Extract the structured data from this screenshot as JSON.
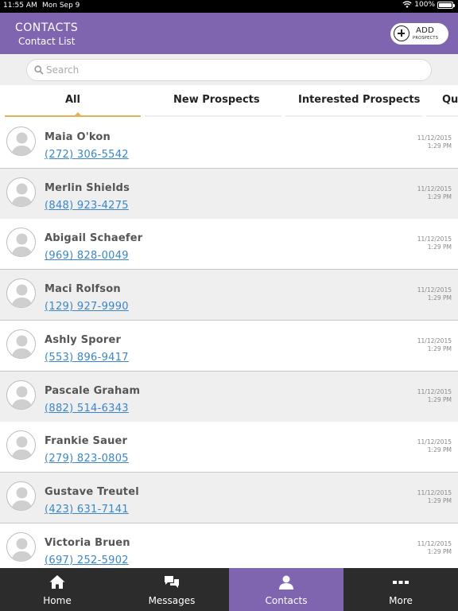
{
  "status_bar": {
    "time": "11:55 AM",
    "date": "Mon Sep 9",
    "battery": "100%"
  },
  "header": {
    "title": "CONTACTS",
    "subtitle": "Contact List",
    "add_button": {
      "label": "ADD",
      "sublabel": "PROSPECTS"
    }
  },
  "search": {
    "placeholder": "Search",
    "value": ""
  },
  "tabs": [
    {
      "label": "All",
      "active": true
    },
    {
      "label": "New Prospects",
      "active": false
    },
    {
      "label": "Interested Prospects",
      "active": false
    },
    {
      "label": "Qu",
      "active": false
    }
  ],
  "contacts": [
    {
      "name": "Maia O'kon",
      "phone": "(272) 306-5542",
      "date": "11/12/2015",
      "time": "1:29 PM"
    },
    {
      "name": "Merlin Shields",
      "phone": "(848) 923-4275",
      "date": "11/12/2015",
      "time": "1:29 PM"
    },
    {
      "name": "Abigail Schaefer",
      "phone": "(969) 828-0049",
      "date": "11/12/2015",
      "time": "1:29 PM"
    },
    {
      "name": "Maci Rolfson",
      "phone": "(129) 927-9990",
      "date": "11/12/2015",
      "time": "1:29 PM"
    },
    {
      "name": "Ashly Sporer",
      "phone": "(553) 896-9417",
      "date": "11/12/2015",
      "time": "1:29 PM"
    },
    {
      "name": "Pascale Graham",
      "phone": "(882) 514-6343",
      "date": "11/12/2015",
      "time": "1:29 PM"
    },
    {
      "name": "Frankie Sauer",
      "phone": "(279) 823-0805",
      "date": "11/12/2015",
      "time": "1:29 PM"
    },
    {
      "name": "Gustave Treutel",
      "phone": "(423) 631-7141",
      "date": "11/12/2015",
      "time": "1:29 PM"
    },
    {
      "name": "Victoria Bruen",
      "phone": "(697) 252-5902",
      "date": "11/12/2015",
      "time": "1:29 PM"
    }
  ],
  "tab_bar": [
    {
      "label": "Home",
      "icon": "home-icon",
      "active": false
    },
    {
      "label": "Messages",
      "icon": "messages-icon",
      "active": false
    },
    {
      "label": "Contacts",
      "icon": "contacts-icon",
      "active": true
    },
    {
      "label": "More",
      "icon": "more-icon",
      "active": false
    }
  ],
  "colors": {
    "header": "#7f64b0",
    "tab_indicator": "#e2b25a",
    "link": "#3a86c8",
    "tab_bar": "#2c2c2c"
  }
}
